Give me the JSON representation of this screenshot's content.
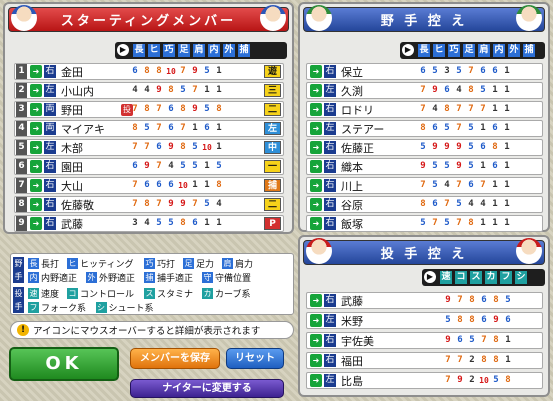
{
  "starting": {
    "title": "スターティングメンバー",
    "headers": [
      "長",
      "ヒ",
      "巧",
      "足",
      "肩",
      "内",
      "外",
      "捕"
    ],
    "rows": [
      {
        "num": "1",
        "bats": "右",
        "name": "金田",
        "stats": [
          "6",
          "8",
          "8",
          "10",
          "7",
          "9",
          "5",
          "1"
        ],
        "pos": "遊"
      },
      {
        "num": "2",
        "bats": "左",
        "name": "小山内",
        "stats": [
          "4",
          "4",
          "9",
          "8",
          "5",
          "7",
          "1",
          "1"
        ],
        "pos": "三"
      },
      {
        "num": "3",
        "bats": "両",
        "name": "野田",
        "stats": [
          "7",
          "8",
          "7",
          "6",
          "8",
          "9",
          "5",
          "8"
        ],
        "pos": "二",
        "extra": "投"
      },
      {
        "num": "4",
        "bats": "両",
        "name": "マイアキ",
        "stats": [
          "8",
          "5",
          "7",
          "6",
          "7",
          "1",
          "6",
          "1"
        ],
        "pos": "左"
      },
      {
        "num": "5",
        "bats": "左",
        "name": "木部",
        "stats": [
          "7",
          "7",
          "6",
          "9",
          "8",
          "5",
          "10",
          "1"
        ],
        "pos": "中"
      },
      {
        "num": "6",
        "bats": "右",
        "name": "園田",
        "stats": [
          "6",
          "9",
          "7",
          "4",
          "5",
          "5",
          "1",
          "5"
        ],
        "pos": "一"
      },
      {
        "num": "7",
        "bats": "右",
        "name": "大山",
        "stats": [
          "7",
          "6",
          "6",
          "6",
          "10",
          "1",
          "1",
          "8"
        ],
        "pos": "捕"
      },
      {
        "num": "8",
        "bats": "右",
        "name": "佐藤敬",
        "stats": [
          "7",
          "8",
          "7",
          "9",
          "9",
          "7",
          "5",
          "4"
        ],
        "pos": "二"
      },
      {
        "num": "9",
        "bats": "右",
        "name": "武藤",
        "stats": [
          "3",
          "4",
          "5",
          "5",
          "8",
          "6",
          "1",
          "1"
        ],
        "pos": "P"
      }
    ]
  },
  "bench": {
    "title": "野 手 控 え",
    "headers": [
      "長",
      "ヒ",
      "巧",
      "足",
      "肩",
      "内",
      "外",
      "捕"
    ],
    "rows": [
      {
        "bats": "右",
        "name": "保立",
        "stats": [
          "6",
          "5",
          "3",
          "5",
          "7",
          "6",
          "6",
          "1"
        ]
      },
      {
        "bats": "左",
        "name": "久渕",
        "stats": [
          "7",
          "9",
          "6",
          "4",
          "8",
          "5",
          "1",
          "1"
        ]
      },
      {
        "bats": "右",
        "name": "ロドリ",
        "stats": [
          "7",
          "4",
          "8",
          "7",
          "7",
          "7",
          "1",
          "1"
        ]
      },
      {
        "bats": "左",
        "name": "ステアー",
        "stats": [
          "8",
          "6",
          "5",
          "7",
          "5",
          "1",
          "6",
          "1"
        ]
      },
      {
        "bats": "右",
        "name": "佐藤正",
        "stats": [
          "5",
          "9",
          "9",
          "9",
          "5",
          "6",
          "8",
          "1"
        ]
      },
      {
        "bats": "右",
        "name": "織本",
        "stats": [
          "9",
          "5",
          "5",
          "9",
          "5",
          "1",
          "6",
          "1"
        ]
      },
      {
        "bats": "右",
        "name": "川上",
        "stats": [
          "7",
          "5",
          "4",
          "7",
          "6",
          "7",
          "1",
          "1"
        ]
      },
      {
        "bats": "右",
        "name": "谷原",
        "stats": [
          "8",
          "6",
          "7",
          "5",
          "4",
          "4",
          "1",
          "1"
        ]
      },
      {
        "bats": "右",
        "name": "飯塚",
        "stats": [
          "5",
          "7",
          "5",
          "7",
          "8",
          "1",
          "1",
          "1"
        ]
      }
    ]
  },
  "pitchers": {
    "title": "投 手 控 え",
    "headers": [
      "速",
      "コ",
      "ス",
      "カ",
      "フ",
      "シ"
    ],
    "rows": [
      {
        "bats": "右",
        "name": "武藤",
        "stats": [
          "9",
          "7",
          "8",
          "6",
          "8",
          "5"
        ]
      },
      {
        "bats": "左",
        "name": "米野",
        "stats": [
          "5",
          "8",
          "8",
          "6",
          "9",
          "6"
        ]
      },
      {
        "bats": "右",
        "name": "宇佐美",
        "stats": [
          "9",
          "6",
          "5",
          "7",
          "8",
          "1"
        ]
      },
      {
        "bats": "右",
        "name": "福田",
        "stats": [
          "7",
          "7",
          "2",
          "8",
          "8",
          "1"
        ]
      },
      {
        "bats": "左",
        "name": "比島",
        "stats": [
          "7",
          "9",
          "2",
          "10",
          "5",
          "8"
        ]
      }
    ]
  },
  "legend": {
    "fielder_label": "野手",
    "pitcher_label": "投手",
    "items1": [
      {
        "k": "長",
        "t": "長打"
      },
      {
        "k": "ヒ",
        "t": "ヒッティング"
      },
      {
        "k": "巧",
        "t": "巧打"
      },
      {
        "k": "足",
        "t": "足力"
      },
      {
        "k": "肩",
        "t": "肩力"
      }
    ],
    "items2": [
      {
        "k": "内",
        "t": "内野適正"
      },
      {
        "k": "外",
        "t": "外野適正"
      },
      {
        "k": "捕",
        "t": "捕手適正"
      },
      {
        "k": "守",
        "t": "守備位置"
      }
    ],
    "items3": [
      {
        "k": "速",
        "t": "速度"
      },
      {
        "k": "コ",
        "t": "コントロール"
      },
      {
        "k": "ス",
        "t": "スタミナ"
      },
      {
        "k": "カ",
        "t": "カーブ系"
      }
    ],
    "items4": [
      {
        "k": "フ",
        "t": "フォーク系"
      },
      {
        "k": "シ",
        "t": "シュート系"
      }
    ]
  },
  "info": "アイコンにマウスオーバーすると詳細が表示されます",
  "buttons": {
    "ok": "OK",
    "save": "メンバーを保存",
    "reset": "リセット",
    "night": "ナイターに変更する"
  },
  "colors": {
    "red_title": "#c81c1c",
    "blue_title": "#24469a",
    "ok_green": "#2f9a2f",
    "save_orange": "#f28a16",
    "reset_blue": "#2f6fd0",
    "night_purple": "#5a3aa8"
  }
}
